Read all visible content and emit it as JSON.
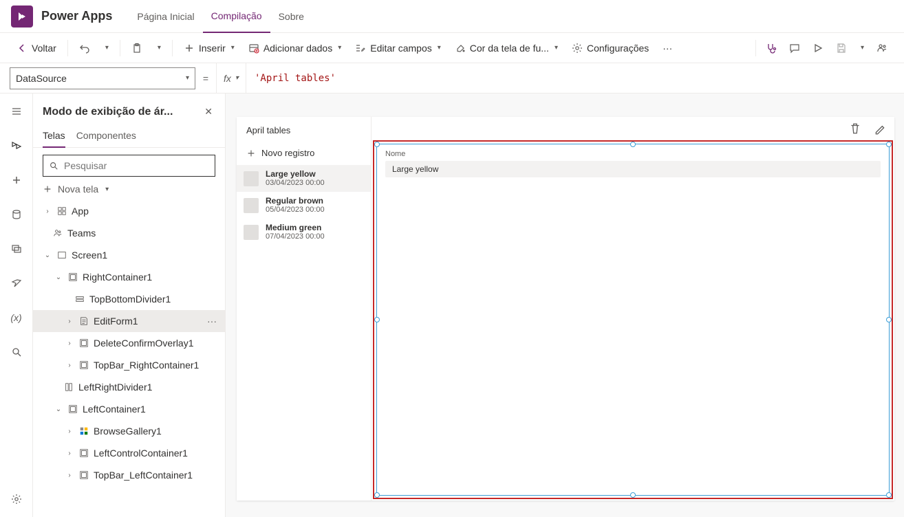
{
  "header": {
    "app_name": "Power Apps",
    "tabs": {
      "home": "Página Inicial",
      "build": "Compilação",
      "about": "Sobre"
    }
  },
  "cmd": {
    "back": "Voltar",
    "insert": "Inserir",
    "add_data": "Adicionar dados",
    "edit_fields": "Editar campos",
    "bg_color": "Cor da tela de fu...",
    "settings": "Configurações"
  },
  "formula": {
    "property": "DataSource",
    "equals": "=",
    "fx": "fx",
    "value": "'April tables'"
  },
  "tree": {
    "title": "Modo de exibição de ár...",
    "tabs": {
      "screens": "Telas",
      "components": "Componentes"
    },
    "search_placeholder": "Pesquisar",
    "new_screen": "Nova tela",
    "nodes": {
      "app": "App",
      "teams": "Teams",
      "screen1": "Screen1",
      "right": "RightContainer1",
      "topbottom": "TopBottomDivider1",
      "editform": "EditForm1",
      "deleteconfirm": "DeleteConfirmOverlay1",
      "topbar_right": "TopBar_RightContainer1",
      "leftright": "LeftRightDivider1",
      "left": "LeftContainer1",
      "browse": "BrowseGallery1",
      "leftctrl": "LeftControlContainer1",
      "topbar_left": "TopBar_LeftContainer1"
    }
  },
  "canvas": {
    "list_title": "April tables",
    "new_record": "Novo registro",
    "records": [
      {
        "name": "Large yellow",
        "date": "03/04/2023 00:00"
      },
      {
        "name": "Regular brown",
        "date": "05/04/2023 00:00"
      },
      {
        "name": "Medium green",
        "date": "07/04/2023 00:00"
      }
    ],
    "form": {
      "field_label": "Nome",
      "field_value": "Large yellow"
    }
  }
}
